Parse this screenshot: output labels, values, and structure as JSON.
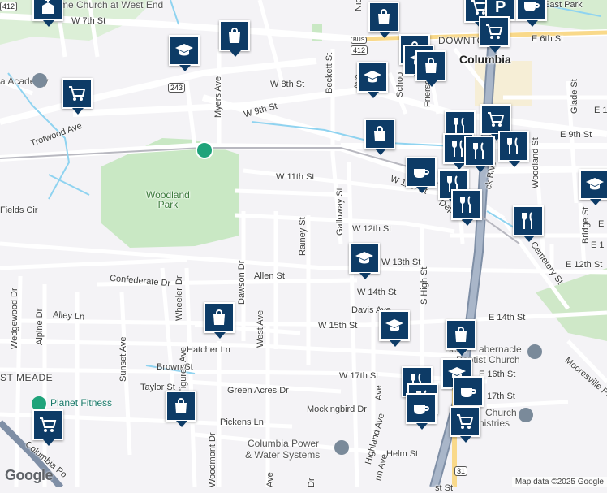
{
  "map": {
    "streets": [
      "W 7th St",
      "W 8th St",
      "W 9th St",
      "W 11th St",
      "W 11th St",
      "W 12th St",
      "W 13th St",
      "W 14th St",
      "W 15th St",
      "W 17th St",
      "E 6th St",
      "E 9th St",
      "E 12th St",
      "E 14th St",
      "E 16th St",
      "17th St",
      "Trotwood Ave",
      "Myers Ave",
      "Beckett St",
      "Rainey St",
      "Galloway St",
      "Allen St",
      "Dawson Dr",
      "West Ave",
      "Wheeler Dr",
      "Confederate Dr",
      "Alley Ln",
      "Hatcher Ln",
      "Brown St",
      "Taylor St",
      "Green Acres Dr",
      "Mockingbird Dr",
      "Pickens Ln",
      "Helm St",
      "Highland Ave",
      "S High St",
      "Depot St",
      "Davis Ave",
      "Cemetery St",
      "Woodland St",
      "Bridge St",
      "Sunset Ave",
      "Alpine Dr",
      "Wedgewood Dr",
      "Figures Ave",
      "Woodmont Dr",
      "Mooresville Pike",
      "Glade St",
      "Fields Cir",
      "Nicholson Ave",
      "Frierson St",
      "E 1",
      "E 12",
      "E 1",
      "Ave",
      "Ave",
      "Ave",
      "st St",
      "Dr",
      "ck Blvd",
      "School",
      "nn Ave",
      "Columbia Po",
      "East Park"
    ],
    "places": {
      "downtown": "DOWNTOWN",
      "city": "Columbia",
      "park": "Woodland\nPark",
      "academy": "a Academy",
      "church_west_end": "me Church at West End",
      "west_meade": "ST MEADE",
      "planet_fitness": "Planet Fitness",
      "bellarabernacle_a": "Bella",
      "bellarabernacle_b": "abernacle",
      "bellarabernacle_c": "Baptist Church",
      "nchurch": "Ne",
      "church_suffix": "Church",
      "ministries": "nistries",
      "power_a": "Columbia Power",
      "power_b": "& Water Systems"
    },
    "shields": [
      "412",
      "412",
      "243",
      "31",
      "BUS"
    ],
    "attribution": "Map data ©2025 Google",
    "logo": "Google"
  },
  "markers": [
    {
      "type": "church-icon"
    },
    {
      "type": "shopping-bag-icon"
    },
    {
      "type": "school-icon"
    },
    {
      "type": "shopping-bag-icon"
    },
    {
      "type": "shopping-cart-icon"
    },
    {
      "type": "parking-icon"
    },
    {
      "type": "coffee-icon"
    },
    {
      "type": "shopping-cart-icon"
    },
    {
      "type": "school-icon"
    },
    {
      "type": "shopping-bag-icon"
    },
    {
      "type": "shopping-cart-icon"
    },
    {
      "type": "school-icon"
    },
    {
      "type": "restaurant-icon"
    },
    {
      "type": "shopping-cart-icon"
    },
    {
      "type": "shopping-bag-icon"
    },
    {
      "type": "shopping-bag-icon"
    },
    {
      "type": "restaurant-icon"
    },
    {
      "type": "restaurant-icon"
    },
    {
      "type": "restaurant-icon"
    },
    {
      "type": "coffee-icon"
    },
    {
      "type": "restaurant-icon"
    },
    {
      "type": "restaurant-icon"
    },
    {
      "type": "school-icon"
    },
    {
      "type": "restaurant-icon"
    },
    {
      "type": "school-icon"
    },
    {
      "type": "school-icon"
    },
    {
      "type": "shopping-bag-icon"
    },
    {
      "type": "school-icon"
    },
    {
      "type": "shopping-bag-icon"
    },
    {
      "type": "shopping-bag-icon"
    },
    {
      "type": "restaurant-icon"
    },
    {
      "type": "restaurant-icon"
    },
    {
      "type": "coffee-icon"
    },
    {
      "type": "shopping-cart-icon"
    },
    {
      "type": "shopping-cart-icon"
    },
    {
      "type": "coffee-icon"
    }
  ]
}
